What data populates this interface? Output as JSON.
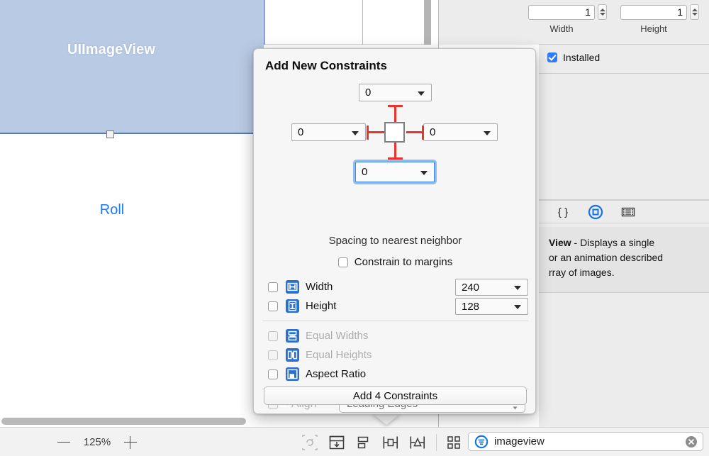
{
  "canvas": {
    "imageview_label": "UIImageView",
    "roll_label": "Roll",
    "zoom_minus": "−",
    "zoom_level": "125%",
    "zoom_plus": "+"
  },
  "toolbar": {
    "icons": [
      {
        "name": "update-frames-icon",
        "label": "Update Frames"
      },
      {
        "name": "resolve-auto-layout-issues-icon",
        "label": "Resolve Auto Layout Issues"
      },
      {
        "name": "align-icon",
        "label": "Align"
      },
      {
        "name": "pin-icon",
        "label": "Add New Constraints"
      },
      {
        "name": "resize-behaviour-icon",
        "label": "Resizing Behaviour"
      }
    ],
    "library_grid_icon": "object-library-icon"
  },
  "search": {
    "value": "imageview",
    "placeholder": "Filter",
    "filter_icon": "filter-icon",
    "clear_icon": "clear-icon"
  },
  "inspector": {
    "width_value": "1",
    "width_caption": "Width",
    "height_value": "1",
    "height_caption": "Height",
    "installed_label": "Installed",
    "installed_checked": true,
    "tabs": [
      {
        "name": "tab-identity-code",
        "glyph": "{ }",
        "selected": false
      },
      {
        "name": "tab-attributes-object",
        "glyph": "◎",
        "selected": true
      },
      {
        "name": "tab-media",
        "glyph": "▤",
        "selected": false
      }
    ],
    "description_bold": "View",
    "description_line1": " - Displays a single",
    "description_line2": "or an animation described",
    "description_line3": "rray of images."
  },
  "popover": {
    "title": "Add New Constraints",
    "spacing": {
      "top_value": "0",
      "left_value": "0",
      "right_value": "0",
      "bottom_value": "0",
      "bottom_focused": true,
      "caption": "Spacing to nearest neighbor"
    },
    "constrain_to_margins": {
      "label": "Constrain to margins",
      "checked": false
    },
    "rows": [
      {
        "name": "width",
        "label": "Width",
        "checked": false,
        "disabled": false,
        "icon": "width-constraint-icon",
        "value": "240"
      },
      {
        "name": "height",
        "label": "Height",
        "checked": false,
        "disabled": false,
        "icon": "height-constraint-icon",
        "value": "128"
      },
      {
        "name": "equal-widths",
        "label": "Equal Widths",
        "checked": false,
        "disabled": true,
        "icon": "equal-widths-icon",
        "value": null
      },
      {
        "name": "equal-heights",
        "label": "Equal Heights",
        "checked": false,
        "disabled": true,
        "icon": "equal-heights-icon",
        "value": null
      },
      {
        "name": "aspect-ratio",
        "label": "Aspect Ratio",
        "checked": false,
        "disabled": false,
        "icon": "aspect-ratio-icon",
        "value": null
      }
    ],
    "align": {
      "label": "Align",
      "checked": false,
      "disabled": true,
      "icon": "align-constraint-icon",
      "selected_option": "Leading Edges"
    },
    "add_button_label": "Add 4 Constraints"
  },
  "colors": {
    "accent_blue": "#2a6ed0",
    "constraint_red": "#e8342c",
    "selection_blue": "#5a76c4",
    "imageview_fill": "#b9cbe4",
    "link_blue": "#1a7df5",
    "focus_ring": "#64a5eb"
  }
}
